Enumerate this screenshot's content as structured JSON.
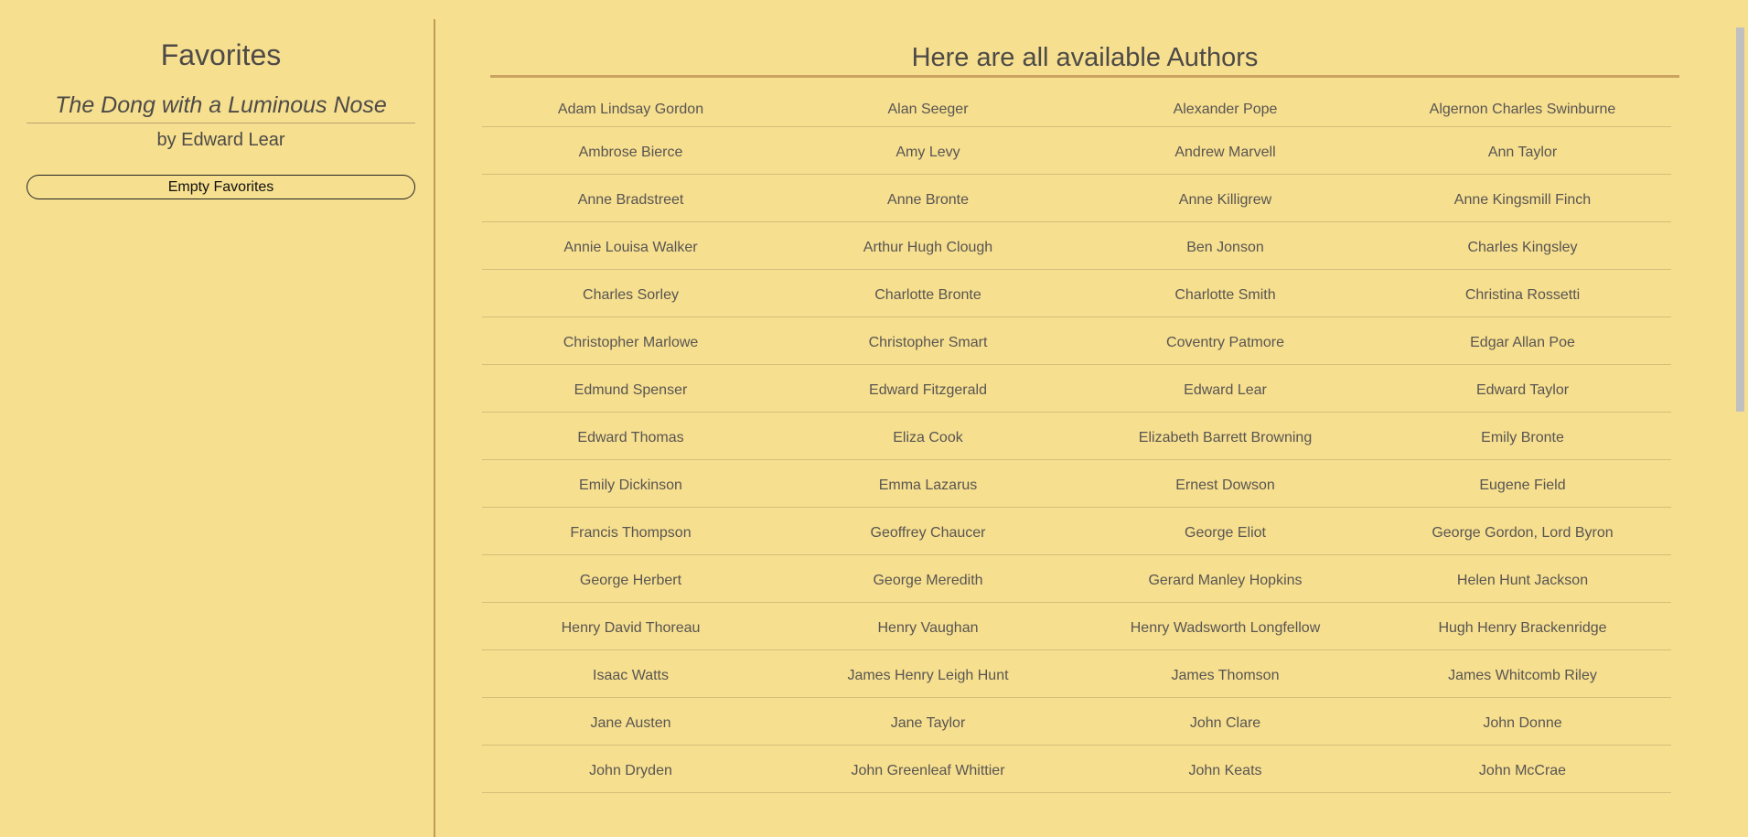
{
  "sidebar": {
    "title": "Favorites",
    "favorite": {
      "poem_title": "The Dong with a Luminous Nose",
      "author_line": "by Edward Lear"
    },
    "empty_button_label": "Empty Favorites"
  },
  "main": {
    "heading": "Here are all available Authors",
    "authors": [
      "Adam Lindsay Gordon",
      "Alan Seeger",
      "Alexander Pope",
      "Algernon Charles Swinburne",
      "Ambrose Bierce",
      "Amy Levy",
      "Andrew Marvell",
      "Ann Taylor",
      "Anne Bradstreet",
      "Anne Bronte",
      "Anne Killigrew",
      "Anne Kingsmill Finch",
      "Annie Louisa Walker",
      "Arthur Hugh Clough",
      "Ben Jonson",
      "Charles Kingsley",
      "Charles Sorley",
      "Charlotte Bronte",
      "Charlotte Smith",
      "Christina Rossetti",
      "Christopher Marlowe",
      "Christopher Smart",
      "Coventry Patmore",
      "Edgar Allan Poe",
      "Edmund Spenser",
      "Edward Fitzgerald",
      "Edward Lear",
      "Edward Taylor",
      "Edward Thomas",
      "Eliza Cook",
      "Elizabeth Barrett Browning",
      "Emily Bronte",
      "Emily Dickinson",
      "Emma Lazarus",
      "Ernest Dowson",
      "Eugene Field",
      "Francis Thompson",
      "Geoffrey Chaucer",
      "George Eliot",
      "George Gordon, Lord Byron",
      "George Herbert",
      "George Meredith",
      "Gerard Manley Hopkins",
      "Helen Hunt Jackson",
      "Henry David Thoreau",
      "Henry Vaughan",
      "Henry Wadsworth Longfellow",
      "Hugh Henry Brackenridge",
      "Isaac Watts",
      "James Henry Leigh Hunt",
      "James Thomson",
      "James Whitcomb Riley",
      "Jane Austen",
      "Jane Taylor",
      "John Clare",
      "John Donne",
      "John Dryden",
      "John Greenleaf Whittier",
      "John Keats",
      "John McCrae"
    ]
  }
}
